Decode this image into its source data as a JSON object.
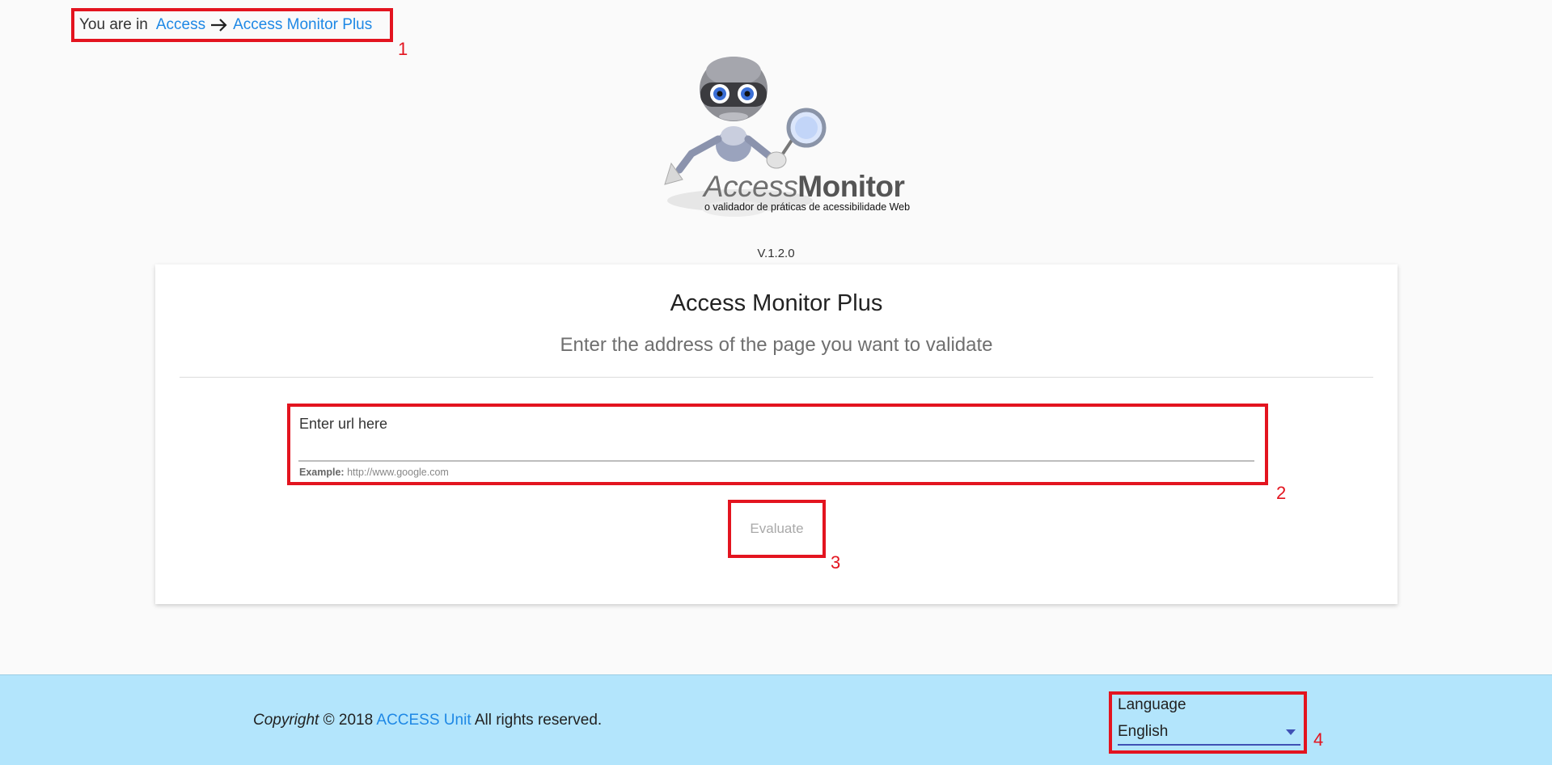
{
  "breadcrumb": {
    "prefix": "You are in",
    "items": [
      "Access",
      "Access Monitor Plus"
    ]
  },
  "logo": {
    "title_light": "Access",
    "title_bold": "Monitor",
    "tagline": "o validador de práticas de acessibilidade Web",
    "icon": "robot-with-magnifier-icon"
  },
  "version": "V.1.2.0",
  "card": {
    "title": "Access Monitor Plus",
    "subtitle": "Enter the address of the page you want to validate",
    "url_field": {
      "label": "Enter url here",
      "value": "",
      "hint_prefix": "Example:",
      "hint_value": "http://www.google.com"
    },
    "evaluate_label": "Evaluate"
  },
  "footer": {
    "copyright_italic": "Copyright",
    "copyright_year": "© 2018",
    "org_link": "ACCESS Unit",
    "rights": "All rights reserved.",
    "language_label": "Language",
    "language_value": "English"
  },
  "markers": [
    "1",
    "2",
    "3",
    "4"
  ],
  "colors": {
    "annotation_red": "#e3141f",
    "link_blue": "#1e88e5",
    "footer_bg": "#b3e5fc",
    "select_accent": "#3f51b5"
  }
}
